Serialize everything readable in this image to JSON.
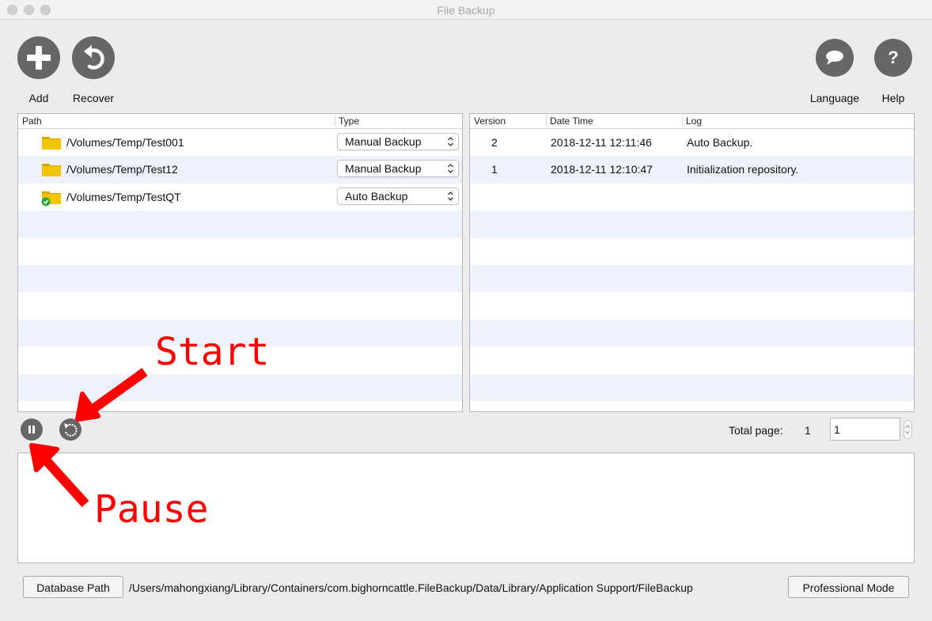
{
  "window": {
    "title": "File Backup"
  },
  "toolbar": {
    "add_label": "Add",
    "recover_label": "Recover",
    "language_label": "Language",
    "help_label": "Help"
  },
  "folders_table": {
    "headers": {
      "path": "Path",
      "type": "Type"
    },
    "rows": [
      {
        "path": "/Volumes/Temp/Test001",
        "type": "Manual Backup",
        "status": "folder-icon"
      },
      {
        "path": "/Volumes/Temp/Test12",
        "type": "Manual Backup",
        "status": "folder-icon"
      },
      {
        "path": "/Volumes/Temp/TestQT",
        "type": "Auto Backup",
        "status": "folder-check-icon"
      }
    ]
  },
  "versions_table": {
    "headers": {
      "version": "Version",
      "datetime": "Date Time",
      "log": "Log"
    },
    "rows": [
      {
        "version": "2",
        "datetime": "2018-12-11 12:11:46",
        "log": "Auto Backup."
      },
      {
        "version": "1",
        "datetime": "2018-12-11 12:10:47",
        "log": "Initialization repository."
      }
    ]
  },
  "pagination": {
    "total_label": "Total page:",
    "total_value": "1",
    "current_page": "1"
  },
  "footer": {
    "database_button": "Database Path",
    "database_path": "/Users/mahongxiang/Library/Containers/com.bighorncattle.FileBackup/Data/Library/Application Support/FileBackup",
    "professional_button": "Professional Mode"
  },
  "annotations": {
    "start": "Start",
    "pause": "Pause"
  },
  "colors": {
    "icon_gray": "#666666",
    "stripe": "#edf2fc",
    "folder": "#f2c500",
    "check": "#2fa640",
    "annotation": "#ff0000"
  }
}
